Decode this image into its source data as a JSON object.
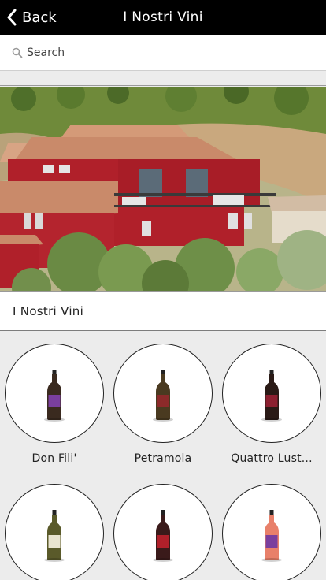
{
  "navbar": {
    "back_label": "Back",
    "title": "I Nostri Vini"
  },
  "search": {
    "placeholder": "Search"
  },
  "section": {
    "title": "I Nostri Vini"
  },
  "wines": [
    {
      "name": "Don Fili'",
      "bottle": "red-bottle",
      "label_color": "#7a3f9e",
      "glass_color": "#3a2a1f"
    },
    {
      "name": "Petramola",
      "bottle": "white-bottle",
      "label_color": "#8c2a2a",
      "glass_color": "#4a3a20"
    },
    {
      "name": "Quattro Lust...",
      "bottle": "red-bottle",
      "label_color": "#8c2030",
      "glass_color": "#2a1a16"
    },
    {
      "name": "",
      "bottle": "white-bottle",
      "label_color": "#e9e4d0",
      "glass_color": "#5a5a2a"
    },
    {
      "name": "",
      "bottle": "red-bottle",
      "label_color": "#b0202a",
      "glass_color": "#3a1a1a"
    },
    {
      "name": "",
      "bottle": "rose-bottle",
      "label_color": "#7a3f9e",
      "glass_color": "#e8806a"
    }
  ],
  "colors": {
    "navbar_bg": "#000000",
    "background": "#ececec",
    "building": "#b0202a",
    "roof": "#c98a6a"
  }
}
